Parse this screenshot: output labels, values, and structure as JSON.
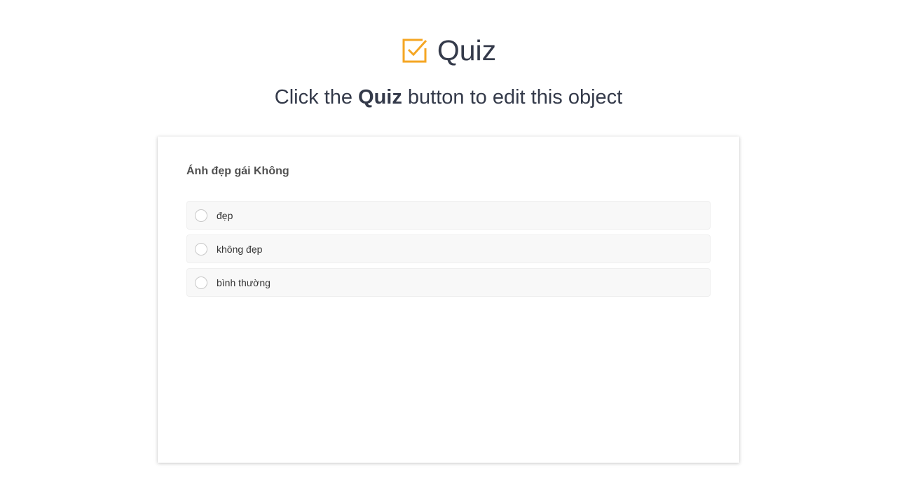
{
  "header": {
    "title": "Quiz",
    "icon": "checkbox-icon",
    "accent_color": "#f5a623"
  },
  "subtitle": {
    "prefix": "Click the ",
    "emphasis": "Quiz",
    "suffix": " button to edit this object"
  },
  "quiz": {
    "question": "Ánh đẹp gái Không",
    "options": [
      {
        "label": "đẹp",
        "selected": false
      },
      {
        "label": "không đẹp",
        "selected": false
      },
      {
        "label": "bình thường",
        "selected": false
      }
    ]
  }
}
